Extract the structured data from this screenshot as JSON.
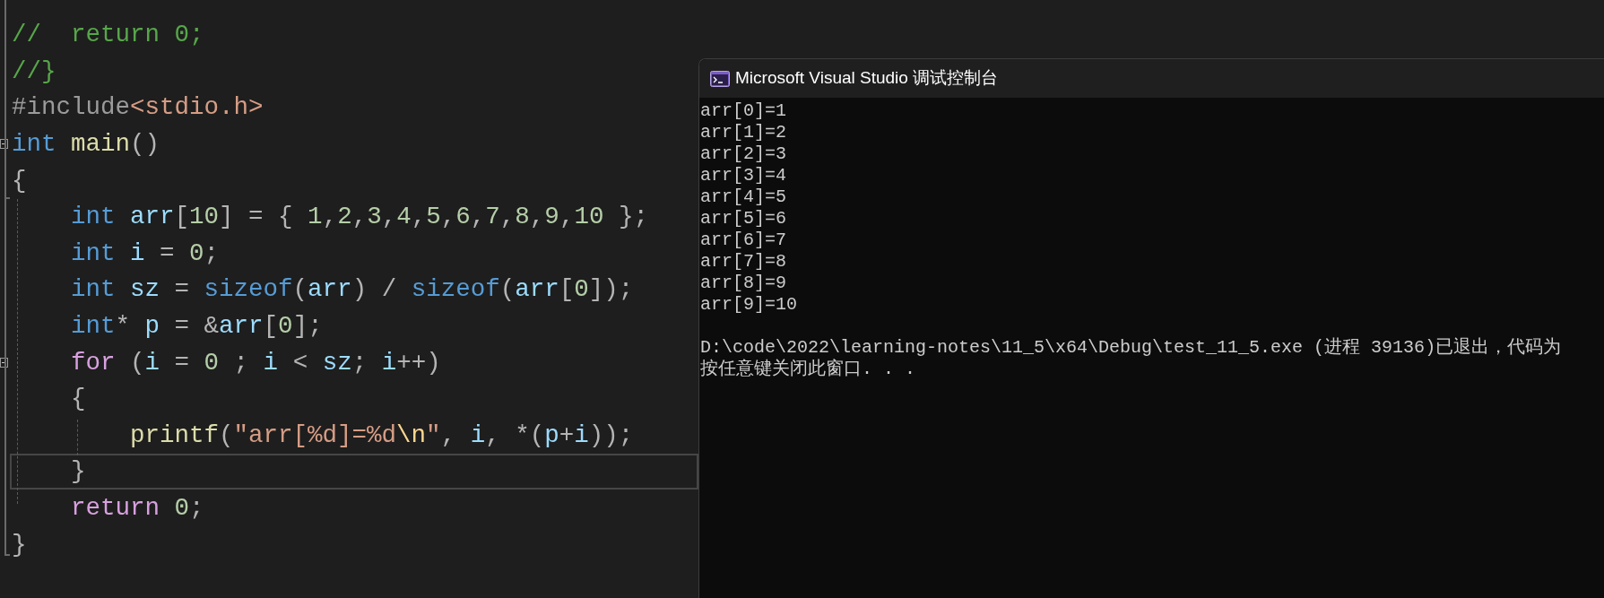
{
  "editor": {
    "lines": [
      {
        "collapsible": false,
        "current": false,
        "tokens": [
          {
            "text": "//  return 0;",
            "kind": "comment"
          }
        ]
      },
      {
        "collapsible": false,
        "current": false,
        "tokens": [
          {
            "text": "//}",
            "kind": "comment"
          }
        ]
      },
      {
        "collapsible": false,
        "current": false,
        "tokens": [
          {
            "text": "#include",
            "kind": "preprocessor"
          },
          {
            "text": "<stdio.h>",
            "kind": "string"
          }
        ]
      },
      {
        "collapsible": true,
        "current": false,
        "tokens": [
          {
            "text": "int",
            "kind": "keyword"
          },
          {
            "text": " main",
            "kind": "function"
          },
          {
            "text": "()",
            "kind": "punct"
          }
        ]
      },
      {
        "collapsible": false,
        "current": false,
        "tokens": [
          {
            "text": "{",
            "kind": "punct"
          }
        ]
      },
      {
        "collapsible": false,
        "current": false,
        "tokens": [
          {
            "text": "    int",
            "kind": "keyword"
          },
          {
            "text": " arr",
            "kind": "variable"
          },
          {
            "text": "[",
            "kind": "punct"
          },
          {
            "text": "10",
            "kind": "number"
          },
          {
            "text": "] = { ",
            "kind": "punct"
          },
          {
            "text": "1",
            "kind": "number"
          },
          {
            "text": ",",
            "kind": "punct"
          },
          {
            "text": "2",
            "kind": "number"
          },
          {
            "text": ",",
            "kind": "punct"
          },
          {
            "text": "3",
            "kind": "number"
          },
          {
            "text": ",",
            "kind": "punct"
          },
          {
            "text": "4",
            "kind": "number"
          },
          {
            "text": ",",
            "kind": "punct"
          },
          {
            "text": "5",
            "kind": "number"
          },
          {
            "text": ",",
            "kind": "punct"
          },
          {
            "text": "6",
            "kind": "number"
          },
          {
            "text": ",",
            "kind": "punct"
          },
          {
            "text": "7",
            "kind": "number"
          },
          {
            "text": ",",
            "kind": "punct"
          },
          {
            "text": "8",
            "kind": "number"
          },
          {
            "text": ",",
            "kind": "punct"
          },
          {
            "text": "9",
            "kind": "number"
          },
          {
            "text": ",",
            "kind": "punct"
          },
          {
            "text": "10",
            "kind": "number"
          },
          {
            "text": " };",
            "kind": "punct"
          }
        ]
      },
      {
        "collapsible": false,
        "current": false,
        "tokens": [
          {
            "text": "    int",
            "kind": "keyword"
          },
          {
            "text": " i",
            "kind": "variable"
          },
          {
            "text": " = ",
            "kind": "punct"
          },
          {
            "text": "0",
            "kind": "number"
          },
          {
            "text": ";",
            "kind": "punct"
          }
        ]
      },
      {
        "collapsible": false,
        "current": false,
        "tokens": [
          {
            "text": "    int",
            "kind": "keyword"
          },
          {
            "text": " sz",
            "kind": "variable"
          },
          {
            "text": " = ",
            "kind": "punct"
          },
          {
            "text": "sizeof",
            "kind": "keyword"
          },
          {
            "text": "(",
            "kind": "punct"
          },
          {
            "text": "arr",
            "kind": "variable"
          },
          {
            "text": ") / ",
            "kind": "punct"
          },
          {
            "text": "sizeof",
            "kind": "keyword"
          },
          {
            "text": "(",
            "kind": "punct"
          },
          {
            "text": "arr",
            "kind": "variable"
          },
          {
            "text": "[",
            "kind": "punct"
          },
          {
            "text": "0",
            "kind": "number"
          },
          {
            "text": "]);",
            "kind": "punct"
          }
        ]
      },
      {
        "collapsible": false,
        "current": false,
        "tokens": [
          {
            "text": "    int",
            "kind": "keyword"
          },
          {
            "text": "* ",
            "kind": "punct"
          },
          {
            "text": "p",
            "kind": "variable"
          },
          {
            "text": " = &",
            "kind": "punct"
          },
          {
            "text": "arr",
            "kind": "variable"
          },
          {
            "text": "[",
            "kind": "punct"
          },
          {
            "text": "0",
            "kind": "number"
          },
          {
            "text": "];",
            "kind": "punct"
          }
        ]
      },
      {
        "collapsible": true,
        "current": false,
        "tokens": [
          {
            "text": "    for",
            "kind": "control"
          },
          {
            "text": " (",
            "kind": "punct"
          },
          {
            "text": "i",
            "kind": "variable"
          },
          {
            "text": " = ",
            "kind": "punct"
          },
          {
            "text": "0",
            "kind": "number"
          },
          {
            "text": " ; ",
            "kind": "punct"
          },
          {
            "text": "i",
            "kind": "variable"
          },
          {
            "text": " < ",
            "kind": "punct"
          },
          {
            "text": "sz",
            "kind": "variable"
          },
          {
            "text": "; ",
            "kind": "punct"
          },
          {
            "text": "i",
            "kind": "variable"
          },
          {
            "text": "++)",
            "kind": "punct"
          }
        ]
      },
      {
        "collapsible": false,
        "current": false,
        "tokens": [
          {
            "text": "    {",
            "kind": "punct"
          }
        ]
      },
      {
        "collapsible": false,
        "current": false,
        "tokens": [
          {
            "text": "        printf",
            "kind": "function"
          },
          {
            "text": "(",
            "kind": "punct"
          },
          {
            "text": "\"arr[%d]=%d",
            "kind": "string"
          },
          {
            "text": "\\n",
            "kind": "escape"
          },
          {
            "text": "\"",
            "kind": "string"
          },
          {
            "text": ", ",
            "kind": "punct"
          },
          {
            "text": "i",
            "kind": "variable"
          },
          {
            "text": ", *(",
            "kind": "punct"
          },
          {
            "text": "p",
            "kind": "variable"
          },
          {
            "text": "+",
            "kind": "punct"
          },
          {
            "text": "i",
            "kind": "variable"
          },
          {
            "text": "));",
            "kind": "punct"
          }
        ]
      },
      {
        "collapsible": false,
        "current": true,
        "tokens": [
          {
            "text": "    }",
            "kind": "punct"
          }
        ]
      },
      {
        "collapsible": false,
        "current": false,
        "tokens": [
          {
            "text": "    return",
            "kind": "control"
          },
          {
            "text": " 0",
            "kind": "number"
          },
          {
            "text": ";",
            "kind": "punct"
          }
        ]
      },
      {
        "collapsible": false,
        "current": false,
        "tokens": [
          {
            "text": "}",
            "kind": "punct"
          }
        ]
      }
    ]
  },
  "console": {
    "title": "Microsoft Visual Studio 调试控制台",
    "output": [
      "arr[0]=1",
      "arr[1]=2",
      "arr[2]=3",
      "arr[3]=4",
      "arr[4]=5",
      "arr[5]=6",
      "arr[6]=7",
      "arr[7]=8",
      "arr[8]=9",
      "arr[9]=10"
    ],
    "exit_message": [
      "D:\\code\\2022\\learning-notes\\11_5\\x64\\Debug\\test_11_5.exe (进程 39136)已退出，代码为",
      "按任意键关闭此窗口. . ."
    ]
  }
}
